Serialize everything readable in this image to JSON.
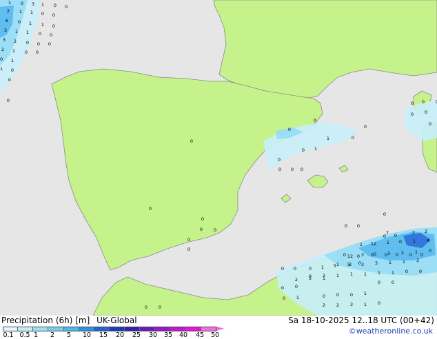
{
  "map": {
    "colors": {
      "sea": "#e6e6e6",
      "land": "#c6f28c",
      "coast": "#8a8a8a",
      "precip_light": "#c8eefa",
      "precip_mid": "#96dcf5",
      "precip_heavy": "#5ab9ee",
      "precip_strong": "#2d6fd9"
    },
    "point_labels": [
      "1",
      "0",
      "3",
      "1",
      "0",
      "0",
      "2",
      "1",
      "1",
      "0",
      "0",
      "6",
      "0",
      "1",
      "1",
      "0",
      "3",
      "1",
      "1",
      "0",
      "0",
      "3",
      "2",
      "0",
      "0",
      "0",
      "2",
      "1",
      "0",
      "0",
      "0",
      "1",
      "1",
      "0",
      "0",
      "0",
      "0",
      "0",
      "0",
      "0",
      "0",
      "1",
      "1",
      "0",
      "0",
      "0",
      "0",
      "0",
      "0",
      "0",
      "0",
      "0",
      "0",
      "0",
      "0",
      "0",
      "0",
      "0",
      "0",
      "0",
      "0",
      "0",
      "0",
      "0",
      "0",
      "0",
      "0",
      "0",
      "0",
      "0",
      "0",
      "0",
      "0",
      "0",
      "0",
      "1",
      "5",
      "5",
      "0",
      "2",
      "2",
      "7",
      "1",
      "12",
      "1",
      "0",
      "1",
      "4",
      "12",
      "3",
      "0",
      "3",
      "2",
      "1",
      "0",
      "1",
      "3",
      "3",
      "3",
      "1",
      "1",
      "3",
      "0",
      "2",
      "1",
      "1",
      "1",
      "1",
      "1",
      "0",
      "0",
      "2",
      "5",
      "1",
      "0",
      "0",
      "0",
      "1",
      "0",
      "0",
      "0",
      "0",
      "0",
      "1",
      "0",
      "0",
      "2",
      "2",
      "3",
      "1",
      "0",
      "1"
    ]
  },
  "bottom_bar": {
    "title": "Precipitation (6h) [m]",
    "model": "UK-Global",
    "datetime": "Sa 18-10-2025 12..18 UTC (00+42)",
    "credit": "©weatheronline.co.uk",
    "scale_ticks": [
      "0.1",
      "0.5",
      "1",
      "2",
      "5",
      "10",
      "15",
      "20",
      "25",
      "30",
      "35",
      "40",
      "45",
      "50"
    ],
    "scale_colors": [
      "#e0f7fd",
      "#bfeefb",
      "#9be0f6",
      "#75cff0",
      "#4fb8ea",
      "#2f92de",
      "#2264d0",
      "#1c3cbf",
      "#3a1fb6",
      "#6a1bbf",
      "#9a18c9",
      "#c815d2",
      "#e815d8",
      "#f070e0"
    ]
  }
}
